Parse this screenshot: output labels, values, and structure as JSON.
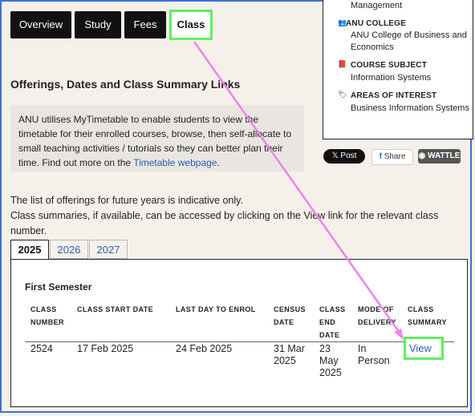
{
  "tabs": [
    "Overview",
    "Study",
    "Fees",
    "Class"
  ],
  "aside": {
    "management_tail": "Management",
    "college_head": "ANU COLLEGE",
    "college_val": "ANU College of Business and Economics",
    "subject_head": "COURSE SUBJECT",
    "subject_val": "Information Systems",
    "interest_head": "AREAS OF INTEREST",
    "interest_val": "Business Information Systems"
  },
  "share": {
    "x": "Post",
    "facebook": "Share",
    "wattle": "WATTLE"
  },
  "heading": "Offerings, Dates and Class Summary Links",
  "note": {
    "text": "ANU utilises MyTimetable to enable students to view the timetable for their enrolled courses, browse, then self-allocate to small teaching activities / tutorials so they can better plan their time. Find out more on the ",
    "link": "Timetable webpage",
    "end": "."
  },
  "info": {
    "line1": "The list of offerings for future years is indicative only.",
    "line2": "Class summaries, if available, can be accessed by clicking on the View link for the relevant class number."
  },
  "years": [
    "2025",
    "2026",
    "2027"
  ],
  "semester": "First Semester",
  "columns": [
    "CLASS NUMBER",
    "CLASS START DATE",
    "LAST DAY TO ENROL",
    "CENSUS DATE",
    "CLASS END DATE",
    "MODE OF DELIVERY",
    "CLASS SUMMARY"
  ],
  "row": {
    "class_number": "2524",
    "start": "17 Feb 2025",
    "enrol": "24 Feb 2025",
    "census": "31 Mar 2025",
    "end": "23 May 2025",
    "mode": "In Person",
    "summary": "View"
  }
}
